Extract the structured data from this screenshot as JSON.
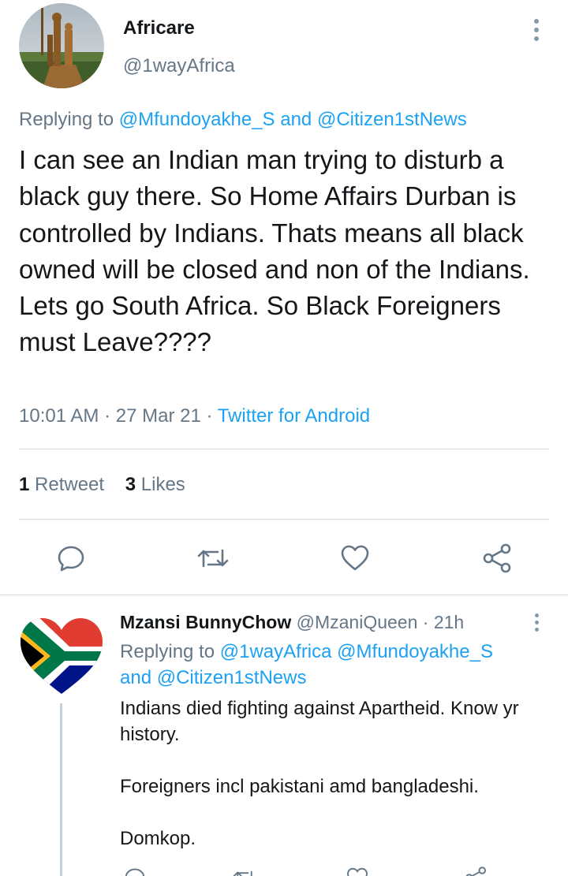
{
  "main_tweet": {
    "author_name": "Africare",
    "author_handle": "@1wayAfrica",
    "replying_prefix": "Replying to ",
    "replying_users": [
      "@Mfundoyakhe_S",
      "@Citizen1stNews"
    ],
    "replying_joiner": " and ",
    "text": "I can see an Indian man trying to disturb a black guy there. So Home Affairs Durban is controlled by Indians. Thats means all black owned will be closed and non of the Indians. Lets go South Africa. So Black Foreigners must Leave????",
    "time": "10:01 AM",
    "date": "27 Mar 21",
    "source": "Twitter for Android",
    "separator": " · ",
    "retweet_count": "1",
    "retweet_label": "Retweet",
    "like_count": "3",
    "like_label": "Likes",
    "actions": [
      "reply-icon",
      "retweet-icon",
      "like-icon",
      "share-icon"
    ]
  },
  "reply_tweet": {
    "author_name": "Mzansi BunnyChow",
    "author_handle": "@MzaniQueen",
    "time_ago": "21h",
    "separator": " · ",
    "replying_prefix": "Replying to ",
    "replying_users": [
      "@1wayAfrica",
      "@Mfundoyakhe_S",
      "@Citizen1stNews"
    ],
    "replying_joiner": "and ",
    "paragraphs": [
      "Indians died fighting against Apartheid. Know yr history.",
      "Foreigners incl pakistani amd bangladeshi.",
      "Domkop."
    ]
  },
  "colors": {
    "link": "#1da1f2",
    "secondary_text": "#657786",
    "primary_text": "#14171a",
    "divider": "#d6dbe0"
  }
}
